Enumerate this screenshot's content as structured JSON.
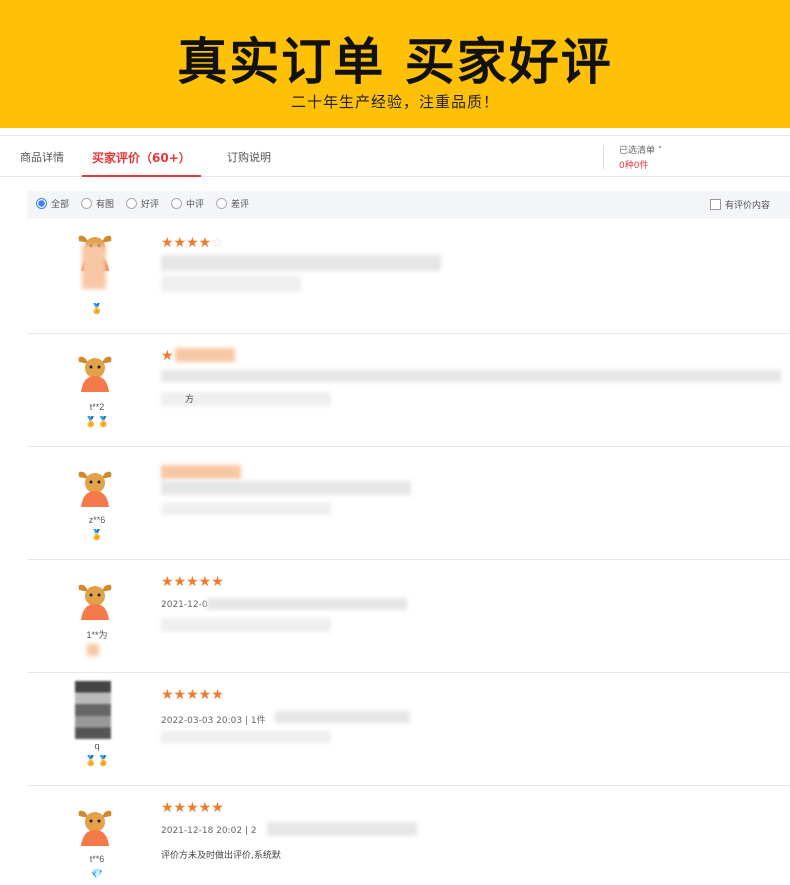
{
  "banner": {
    "title": "真实订单 买家好评",
    "subtitle": "二十年生产经验，注重品质！"
  },
  "tabs": [
    {
      "label": "商品详情",
      "active": false
    },
    {
      "label": "买家评价（60+）",
      "active": true
    },
    {
      "label": "订购说明",
      "active": false
    }
  ],
  "cart": {
    "label": "已选清单 ˄",
    "count": "0种0件"
  },
  "filters": {
    "options": [
      "全部",
      "有图",
      "好评",
      "中评",
      "差评"
    ],
    "selected": "全部",
    "checkbox_label": "有评价内容"
  },
  "reviews": [
    {
      "user": "",
      "badges": "🏅",
      "stars": 4,
      "meta": "",
      "text": ""
    },
    {
      "user": "t**2",
      "badges": "🏅🏅",
      "stars": 1,
      "meta": "",
      "text": "方"
    },
    {
      "user": "z**6",
      "badges": "🏅",
      "stars": 0,
      "meta": "",
      "text": ""
    },
    {
      "user": "1**为",
      "badges": "",
      "stars": 5,
      "meta": "2021-12-0",
      "text": ""
    },
    {
      "user": "q",
      "badges": "🏅🏅",
      "stars": 5,
      "meta": "2022-03-03 20:03 | 1件",
      "text": ""
    },
    {
      "user": "t**6",
      "badges": "💎",
      "stars": 5,
      "meta": "2021-12-18 20:02 | 2",
      "text": "评价方未及时做出评价,系统默"
    }
  ],
  "colors": {
    "banner": "#ffc107",
    "accent": "#e4393c",
    "star": "#f07b2a",
    "radio_checked": "#3b82f6"
  }
}
